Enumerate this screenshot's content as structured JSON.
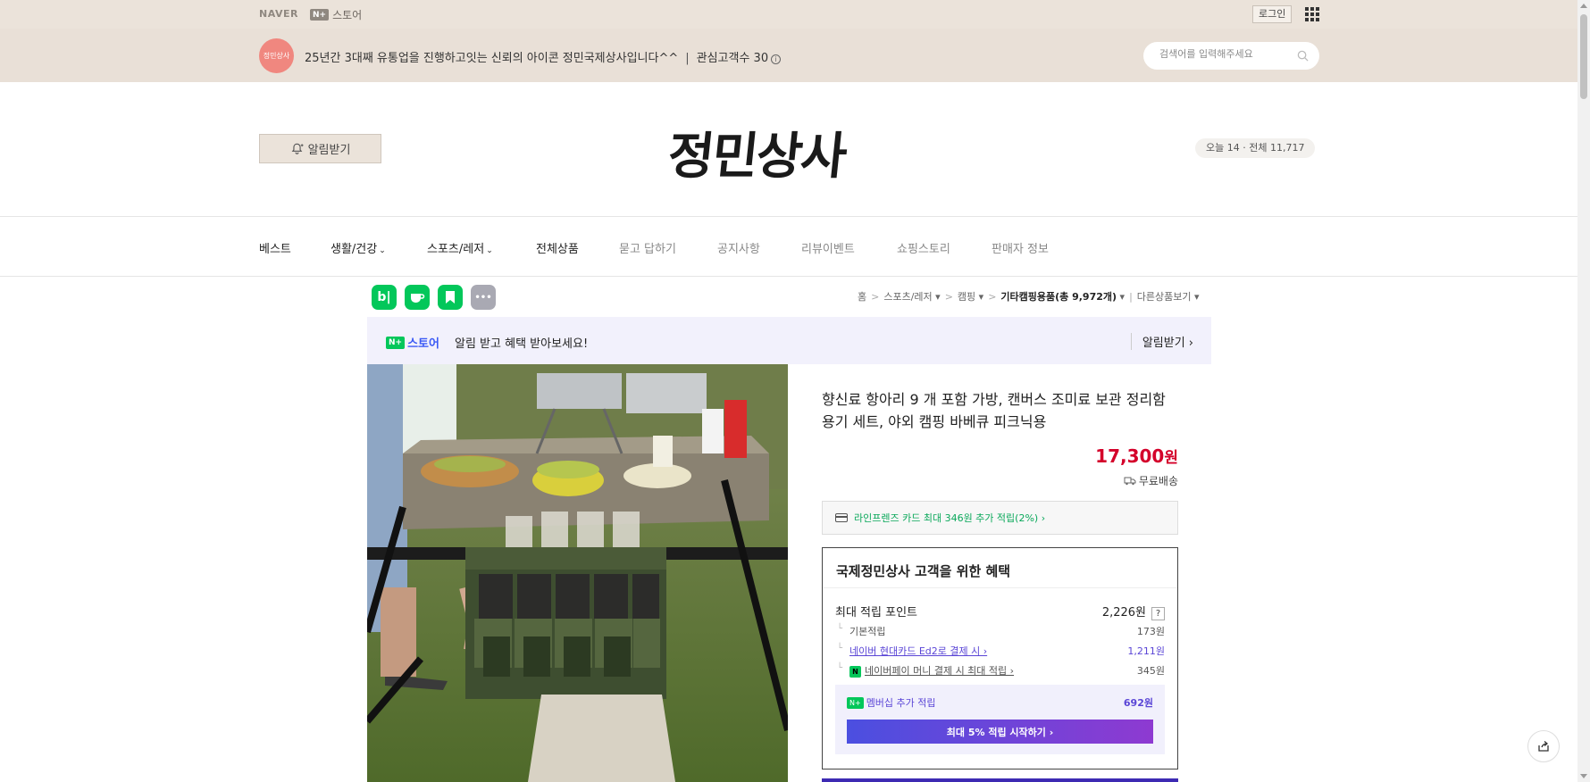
{
  "gnb": {
    "naver_logo": "NAVER",
    "store_badge": "N+",
    "store_label": "스토어",
    "login_label": "로그인"
  },
  "seller": {
    "avatar_text": "정민상사",
    "description": "25년간 3대째 유통업을 진행하고잇는 신뢰의 아이콘 정민국제상사입니다^^",
    "separator": "|",
    "interest_label": "관심고객수 30",
    "search_placeholder": "검색어를 입력해주세요"
  },
  "header": {
    "alarm_label": "알림받기",
    "brand": "정민상사",
    "visit_count": "오늘 14 · 전체 11,717"
  },
  "categories": [
    {
      "label": "베스트",
      "caret": ""
    },
    {
      "label": "생활/건강",
      "caret": "⌄"
    },
    {
      "label": "스포츠/레저",
      "caret": "⌄"
    },
    {
      "label": "전체상품",
      "caret": ""
    },
    {
      "label": "묻고 답하기",
      "caret": ""
    },
    {
      "label": "공지사항",
      "caret": ""
    },
    {
      "label": "리뷰이벤트",
      "caret": ""
    },
    {
      "label": "쇼핑스토리",
      "caret": ""
    },
    {
      "label": "판매자 정보",
      "caret": ""
    }
  ],
  "share": {
    "blog": "b|",
    "more": "•••"
  },
  "breadcrumb": {
    "home": "홈",
    "cat1": "스포츠/레저",
    "cat2": "캠핑",
    "cat3": "기타캠핑용품(총 9,972개)",
    "other": "다른상품보기"
  },
  "notice": {
    "badge": "N+",
    "store": "스토어",
    "text": "알림 받고 혜택 받아보세요!",
    "alarm": "알림받기"
  },
  "product": {
    "title": "향신료 항아리 9 개 포함 가방, 캔버스 조미료 보관 정리함 용기 세트, 야외 캠핑 바베큐 피크닉용",
    "price": "17,300",
    "price_unit": "원",
    "shipping": "무료배송",
    "card_offer": "라인프렌즈 카드 최대 346원 추가 적립(2%) ›"
  },
  "benefit": {
    "title": "국제정민상사 고객을 위한 혜택",
    "max_points_label": "최대 적립 포인트",
    "max_points_value": "2,226원",
    "help": "?",
    "rows": [
      {
        "label": "기본적립",
        "value": "173원"
      },
      {
        "label": "네이버 현대카드 Ed2로 결제 시 ›",
        "value": "1,211원"
      },
      {
        "label": "네이버페이 머니 결제 시 최대 적립 ›",
        "value": "345원"
      }
    ],
    "npay_badge": "N",
    "member_badge": "N+",
    "member_label": "멤버십 추가 적립",
    "member_value": "692원",
    "member_button": "최대 5% 적립 시작하기 ›"
  },
  "colors": {
    "gnb_bg": "#ebe3da",
    "price_red": "#d4002a",
    "naver_green": "#03c75a",
    "benefit_purple": "#5a45d6"
  }
}
